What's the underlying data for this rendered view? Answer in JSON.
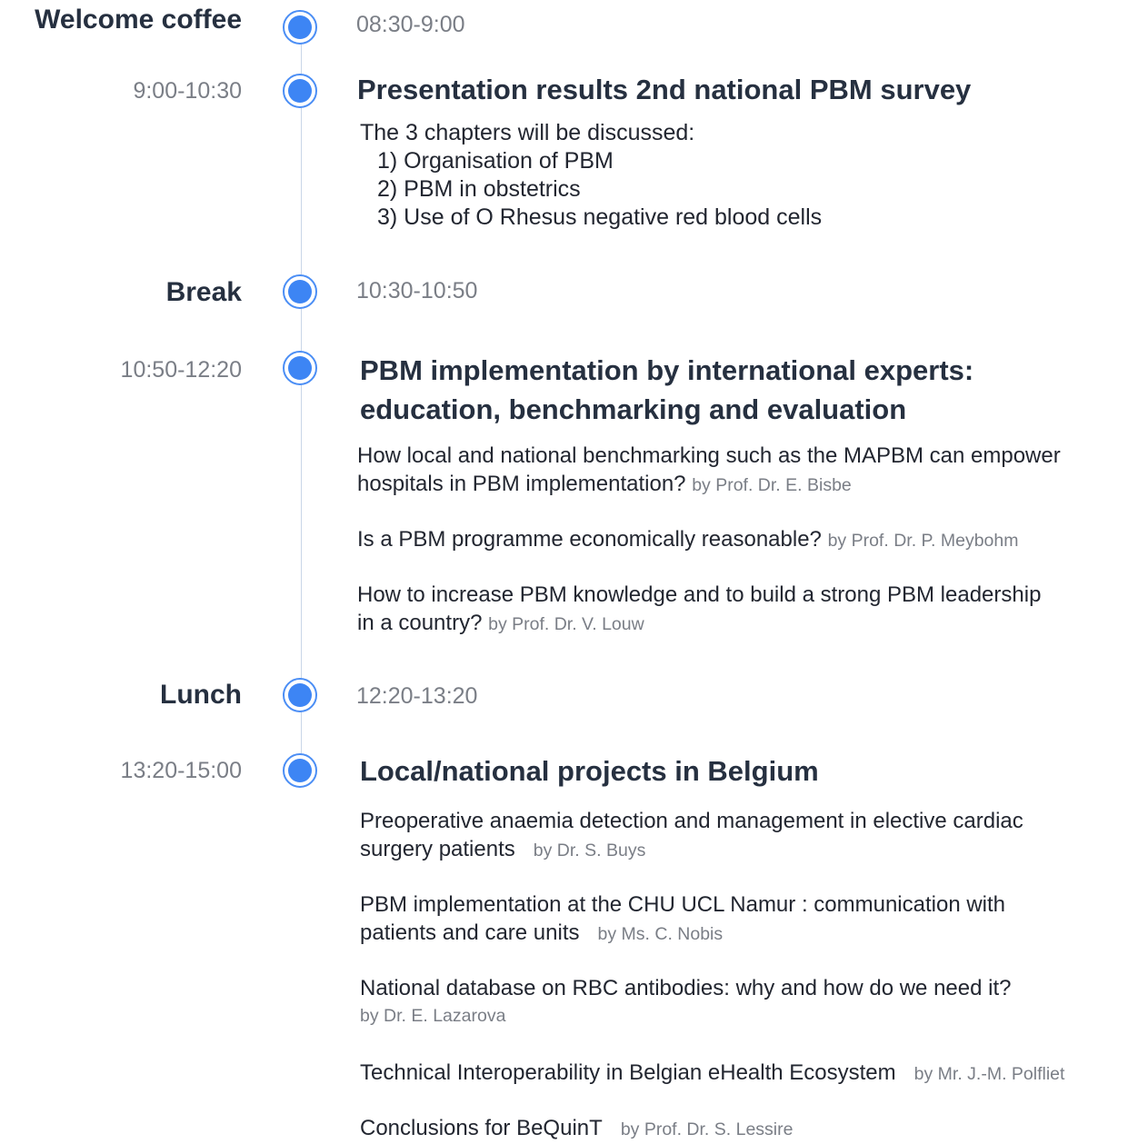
{
  "timeline": [
    {
      "label": "Welcome coffee",
      "time": "08:30-9:00"
    },
    {
      "time": "9:00-10:30",
      "title": "Presentation results 2nd national PBM survey",
      "intro": "The 3 chapters will be discussed:",
      "chapters": [
        "1) Organisation of PBM",
        "2) PBM in obstetrics",
        "3) Use of O Rhesus negative red blood cells"
      ]
    },
    {
      "label": "Break",
      "time": "10:30-10:50"
    },
    {
      "time": "10:50-12:20",
      "title_line1": "PBM implementation by international experts:",
      "title_line2": "education, benchmarking and evaluation",
      "talks": [
        {
          "line1": "How local and national benchmarking such as the MAPBM can empower",
          "line2": "hospitals in PBM implementation?",
          "by": "by Prof. Dr. E. Bisbe"
        },
        {
          "line1": "Is a PBM programme economically reasonable?",
          "by": "by Prof. Dr. P. Meybohm"
        },
        {
          "line1": "How to increase PBM knowledge and to build a strong PBM leadership",
          "line2": "in a country?",
          "by": "by Prof. Dr. V. Louw"
        }
      ]
    },
    {
      "label": "Lunch",
      "time": "12:20-13:20"
    },
    {
      "time": "13:20-15:00",
      "title": "Local/national projects in Belgium",
      "talks": [
        {
          "line1": "Preoperative anaemia detection and management in elective cardiac",
          "line2": "surgery patients",
          "by": "by Dr. S. Buys"
        },
        {
          "line1": "PBM implementation at the CHU UCL Namur : communication with",
          "line2": "patients and care units",
          "by": "by Ms. C. Nobis"
        },
        {
          "line1": "National database on RBC antibodies: why and how do we need it?",
          "by": "by Dr. E. Lazarova"
        },
        {
          "line1": "Technical Interoperability in Belgian eHealth Ecosystem",
          "by": "by Mr. J.-M. Polfliet"
        },
        {
          "line1": "Conclusions for BeQuinT",
          "by": "by Prof. Dr. S. Lessire"
        }
      ]
    }
  ]
}
